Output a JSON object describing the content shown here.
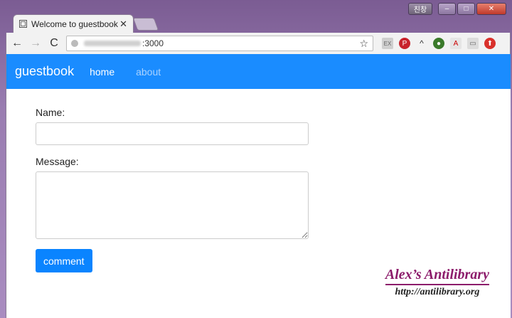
{
  "window": {
    "profile_label": "친창",
    "min_label": "–",
    "max_label": "□",
    "close_label": "✕"
  },
  "tab": {
    "title": "Welcome to guestbook",
    "close_label": "✕"
  },
  "toolbar": {
    "back_label": "←",
    "forward_label": "→",
    "reload_label": "C",
    "url_visible": ":3000",
    "star_label": "☆"
  },
  "extensions": [
    "EX",
    "P",
    "^",
    "●",
    "A",
    "▭",
    "⬆"
  ],
  "nav": {
    "brand": "guestbook",
    "links": [
      {
        "label": "home",
        "active": true
      },
      {
        "label": "about",
        "active": false
      }
    ]
  },
  "form": {
    "name_label": "Name:",
    "name_value": "",
    "message_label": "Message:",
    "message_value": "",
    "submit_label": "comment"
  },
  "watermark": {
    "title": "Alex’s Antilibrary",
    "url": "http://antilibrary.org"
  },
  "colors": {
    "navbar": "#1a8cff",
    "button": "#0a84ff",
    "watermark": "#8c1c6b"
  }
}
